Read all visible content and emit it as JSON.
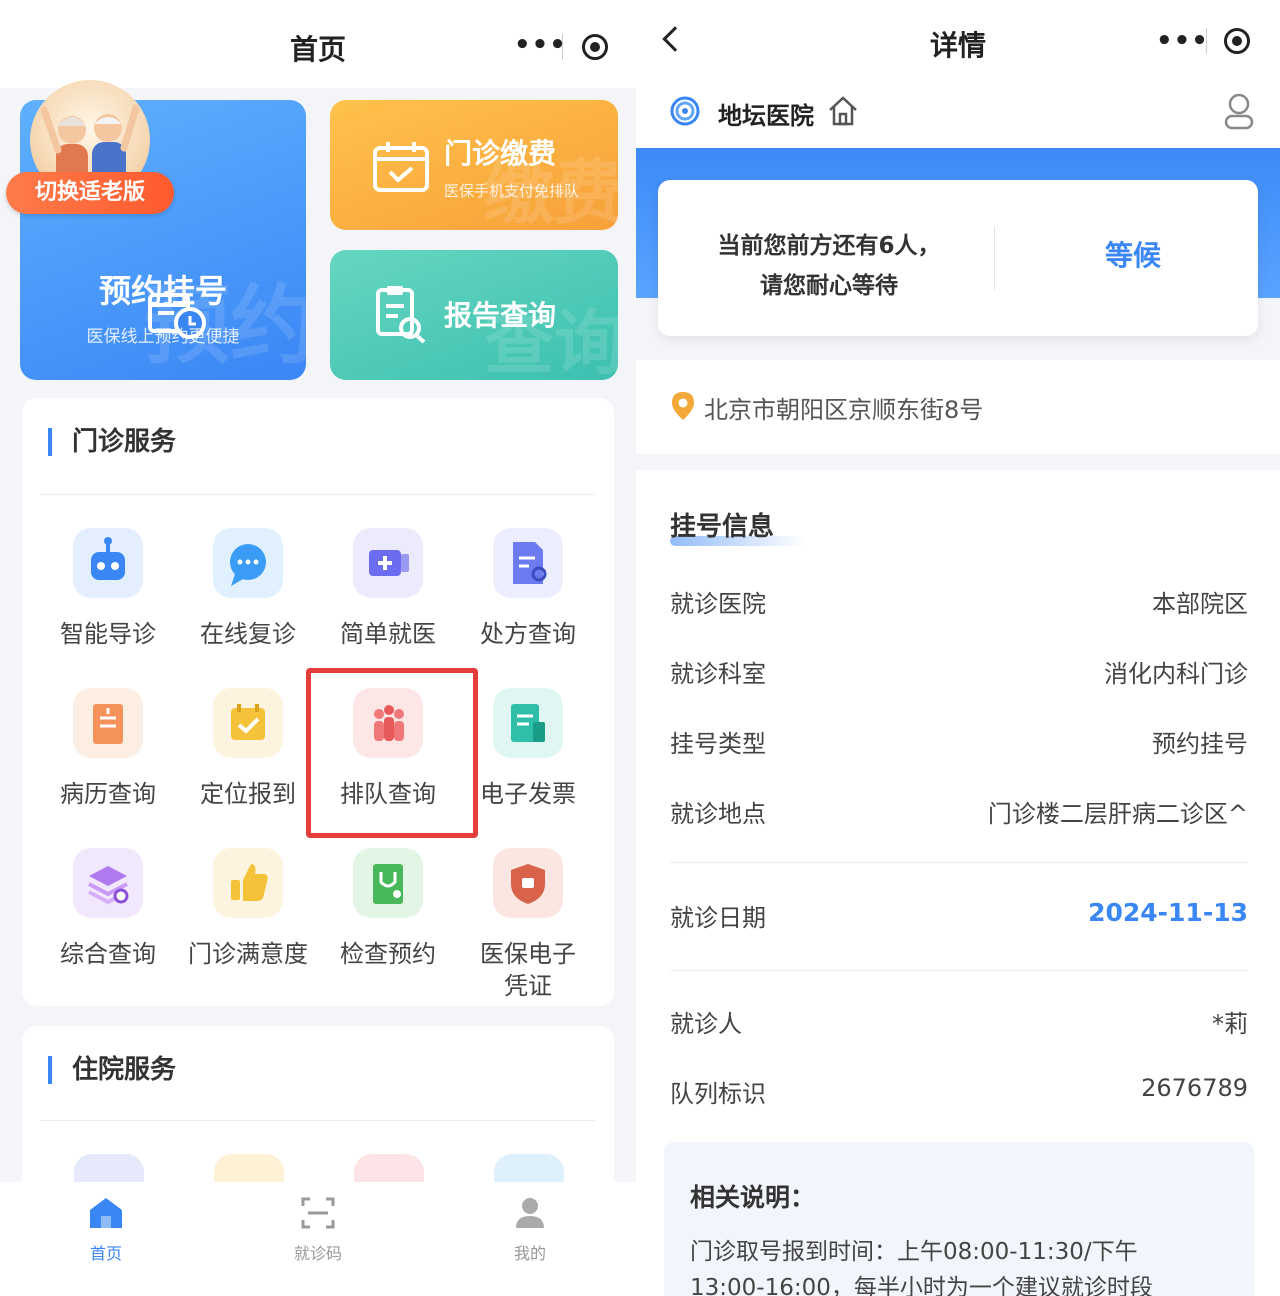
{
  "left": {
    "header": {
      "title": "首页",
      "more_icon": "more-dots-icon",
      "close_icon": "target-icon"
    },
    "elder_toggle": "切换适老版",
    "cards": {
      "appointment": {
        "title": "预约挂号",
        "subtitle": "医保线上预约更便捷",
        "watermark": "预约",
        "icon": "calendar-clock-icon"
      },
      "payment": {
        "title": "门诊缴费",
        "subtitle": "医保手机支付免排队",
        "watermark": "缴费",
        "icon": "calendar-check-icon"
      },
      "report": {
        "title": "报告查询",
        "watermark": "查询",
        "icon": "report-search-icon"
      }
    },
    "outpatient": {
      "heading": "门诊服务",
      "items": [
        {
          "label": "智能导诊",
          "icon": "robot-icon",
          "color": "#3a86f5"
        },
        {
          "label": "在线复诊",
          "icon": "chat-bubble-icon",
          "color": "#3a9cf5"
        },
        {
          "label": "简单就医",
          "icon": "medical-kit-icon",
          "color": "#6c6cf0"
        },
        {
          "label": "处方查询",
          "icon": "prescription-icon",
          "color": "#6c7cf0"
        },
        {
          "label": "病历查询",
          "icon": "medical-record-icon",
          "color": "#f5935a"
        },
        {
          "label": "定位报到",
          "icon": "calendar-check-icon",
          "color": "#f5c33a"
        },
        {
          "label": "排队查询",
          "icon": "queue-people-icon",
          "color": "#f07878"
        },
        {
          "label": "电子发票",
          "icon": "invoice-icon",
          "color": "#2fbfa8"
        },
        {
          "label": "综合查询",
          "icon": "stack-search-icon",
          "color": "#b07af0"
        },
        {
          "label": "门诊满意度",
          "icon": "thumbs-up-icon",
          "color": "#f5c33a"
        },
        {
          "label": "检查预约",
          "icon": "stethoscope-icon",
          "color": "#48b85a"
        },
        {
          "label": "医保电子凭证",
          "icon": "insurance-shield-icon",
          "color": "#d9624a"
        }
      ]
    },
    "inpatient": {
      "heading": "住院服务"
    },
    "tabbar": [
      {
        "label": "首页",
        "icon": "home-icon",
        "active": true
      },
      {
        "label": "就诊码",
        "icon": "scan-code-icon",
        "active": false
      },
      {
        "label": "我的",
        "icon": "user-icon",
        "active": false
      }
    ]
  },
  "right": {
    "header": {
      "title": "详情",
      "back_icon": "chevron-left-icon",
      "more_icon": "more-dots-icon",
      "close_icon": "target-icon"
    },
    "hospital": {
      "name": "地坛医院",
      "logo": "hospital-logo-icon",
      "home_icon": "home-outline-icon",
      "user_icon": "user-outline-icon"
    },
    "wait": {
      "line1": "当前您前方还有6人，",
      "line2": "请您耐心等待",
      "status": "等候"
    },
    "address": "北京市朝阳区京顺东街8号",
    "registration": {
      "title": "挂号信息",
      "rows": [
        {
          "key": "就诊医院",
          "value": "本部院区"
        },
        {
          "key": "就诊科室",
          "value": "消化内科门诊"
        },
        {
          "key": "挂号类型",
          "value": "预约挂号"
        },
        {
          "key": "就诊地点",
          "value": "门诊楼二层肝病二诊区^"
        }
      ],
      "date": {
        "key": "就诊日期",
        "value": "2024-11-13"
      },
      "patient": {
        "key": "就诊人",
        "value": "*莉"
      },
      "queue": {
        "key": "队列标识",
        "value": "2676789"
      }
    },
    "note": {
      "title": "相关说明：",
      "line1": "门诊取号报到时间：上午08:00-11:30/下午",
      "line2": "13:00-16:00，每半小时为一个建议就诊时段"
    }
  },
  "colors": {
    "primary": "#3a86f5",
    "highlight": "#e53c3c",
    "elder_button": "#ff6a38"
  }
}
